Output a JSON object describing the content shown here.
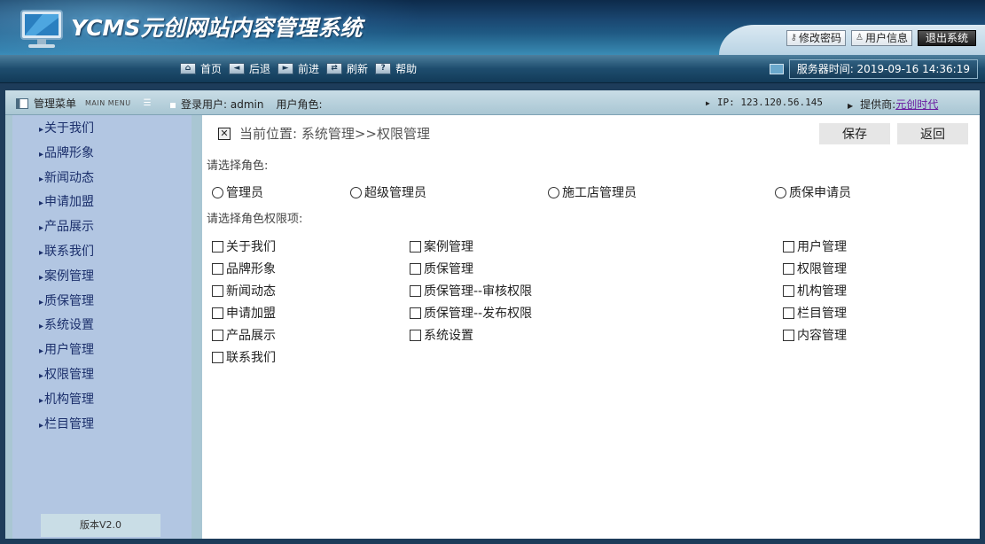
{
  "header": {
    "logo_text": "YCMS元创网站内容管理系统",
    "buttons": [
      {
        "label": "修改密码",
        "icon": "key-icon"
      },
      {
        "label": "用户信息",
        "icon": "user-icon"
      },
      {
        "label": "退出系统",
        "icon": ""
      }
    ]
  },
  "toolbar": {
    "nav": [
      {
        "label": "首页",
        "icon": "home-icon",
        "glyph": "⌂"
      },
      {
        "label": "后退",
        "icon": "back-arrow-icon",
        "glyph": "◄"
      },
      {
        "label": "前进",
        "icon": "forward-arrow-icon",
        "glyph": "►"
      },
      {
        "label": "刷新",
        "icon": "refresh-icon",
        "glyph": "⇄"
      },
      {
        "label": "帮助",
        "icon": "help-icon",
        "glyph": "?"
      }
    ],
    "server_time": "服务器时间: 2019-09-16 14:36:19"
  },
  "infobar": {
    "menu_title": "管理菜单",
    "menu_title_en": "MAIN MENU",
    "login_user": "登录用户: admin",
    "user_role": "用户角色:",
    "ip": "IP: 123.120.56.145",
    "provider_label": "提供商:",
    "provider_name": "元创时代"
  },
  "sidebar": {
    "items": [
      "关于我们",
      "品牌形象",
      "新闻动态",
      "申请加盟",
      "产品展示",
      "联系我们",
      "案例管理",
      "质保管理",
      "系统设置",
      "用户管理",
      "权限管理",
      "机构管理",
      "栏目管理"
    ],
    "version": "版本V2.0"
  },
  "content": {
    "breadcrumb": "当前位置: 系统管理>>权限管理",
    "save_label": "保存",
    "back_label": "返回",
    "role_prompt": "请选择角色:",
    "roles": [
      "管理员",
      "超级管理员",
      "施工店管理员",
      "质保申请员"
    ],
    "perm_prompt": "请选择角色权限项:",
    "perms_col1": [
      "关于我们",
      "品牌形象",
      "新闻动态",
      "申请加盟",
      "产品展示",
      "联系我们"
    ],
    "perms_col2": [
      "案例管理",
      "质保管理",
      "质保管理--审核权限",
      "质保管理--发布权限",
      "系统设置"
    ],
    "perms_col3": [
      "用户管理",
      "权限管理",
      "机构管理",
      "栏目管理",
      "内容管理"
    ]
  }
}
